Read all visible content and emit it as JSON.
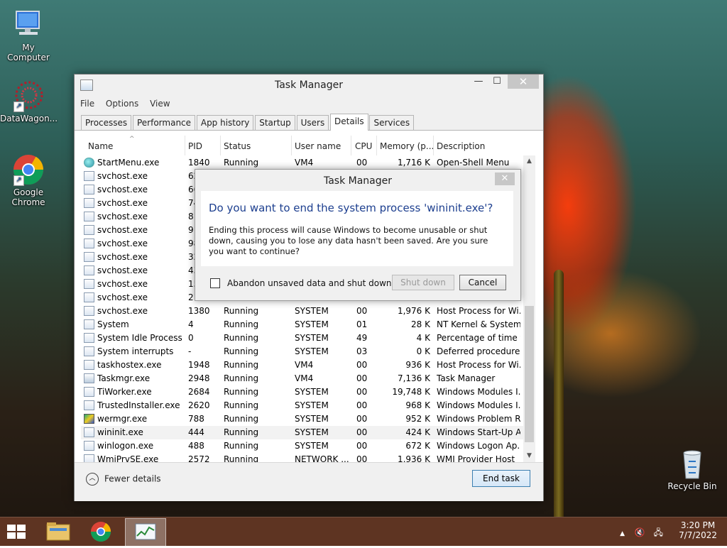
{
  "desktop": {
    "icons": [
      {
        "label": "My Computer"
      },
      {
        "label": "DataWagon..."
      },
      {
        "label": "Google\nChrome"
      },
      {
        "label": "Recycle Bin"
      }
    ]
  },
  "task_manager": {
    "title": "Task Manager",
    "menu": [
      "File",
      "Options",
      "View"
    ],
    "tabs": [
      "Processes",
      "Performance",
      "App history",
      "Startup",
      "Users",
      "Details",
      "Services"
    ],
    "active_tab": "Details",
    "columns": [
      "Name",
      "PID",
      "Status",
      "User name",
      "CPU",
      "Memory (p...",
      "Description"
    ],
    "rows": [
      {
        "name": "StartMenu.exe",
        "pid": "1840",
        "status": "Running",
        "user": "VM4",
        "cpu": "00",
        "mem": "1,716 K",
        "desc": "Open-Shell Menu",
        "icon": "start"
      },
      {
        "name": "svchost.exe",
        "pid": "62",
        "status": "",
        "user": "",
        "cpu": "",
        "mem": "",
        "desc": "",
        "icon": "svc"
      },
      {
        "name": "svchost.exe",
        "pid": "66",
        "status": "",
        "user": "",
        "cpu": "",
        "mem": "",
        "desc": "",
        "icon": "svc"
      },
      {
        "name": "svchost.exe",
        "pid": "74",
        "status": "",
        "user": "",
        "cpu": "",
        "mem": "",
        "desc": "",
        "icon": "svc"
      },
      {
        "name": "svchost.exe",
        "pid": "81",
        "status": "",
        "user": "",
        "cpu": "",
        "mem": "",
        "desc": "",
        "icon": "svc"
      },
      {
        "name": "svchost.exe",
        "pid": "91",
        "status": "",
        "user": "",
        "cpu": "",
        "mem": "",
        "desc": "",
        "icon": "svc"
      },
      {
        "name": "svchost.exe",
        "pid": "98",
        "status": "",
        "user": "",
        "cpu": "",
        "mem": "",
        "desc": "",
        "icon": "svc"
      },
      {
        "name": "svchost.exe",
        "pid": "32",
        "status": "",
        "user": "",
        "cpu": "",
        "mem": "",
        "desc": "",
        "icon": "svc"
      },
      {
        "name": "svchost.exe",
        "pid": "43",
        "status": "",
        "user": "",
        "cpu": "",
        "mem": "",
        "desc": "",
        "icon": "svc"
      },
      {
        "name": "svchost.exe",
        "pid": "15",
        "status": "",
        "user": "",
        "cpu": "",
        "mem": "",
        "desc": "",
        "icon": "svc"
      },
      {
        "name": "svchost.exe",
        "pid": "21",
        "status": "",
        "user": "",
        "cpu": "",
        "mem": "",
        "desc": "",
        "icon": "svc"
      },
      {
        "name": "svchost.exe",
        "pid": "1380",
        "status": "Running",
        "user": "SYSTEM",
        "cpu": "00",
        "mem": "1,976 K",
        "desc": "Host Process for Wi...",
        "icon": "svc"
      },
      {
        "name": "System",
        "pid": "4",
        "status": "Running",
        "user": "SYSTEM",
        "cpu": "01",
        "mem": "28 K",
        "desc": "NT Kernel & System",
        "icon": "svc"
      },
      {
        "name": "System Idle Process",
        "pid": "0",
        "status": "Running",
        "user": "SYSTEM",
        "cpu": "49",
        "mem": "4 K",
        "desc": "Percentage of time t...",
        "icon": "svc"
      },
      {
        "name": "System interrupts",
        "pid": "-",
        "status": "Running",
        "user": "SYSTEM",
        "cpu": "03",
        "mem": "0 K",
        "desc": "Deferred procedure ...",
        "icon": "svc"
      },
      {
        "name": "taskhostex.exe",
        "pid": "1948",
        "status": "Running",
        "user": "VM4",
        "cpu": "00",
        "mem": "936 K",
        "desc": "Host Process for Wi...",
        "icon": "svc"
      },
      {
        "name": "Taskmgr.exe",
        "pid": "2948",
        "status": "Running",
        "user": "VM4",
        "cpu": "00",
        "mem": "7,136 K",
        "desc": "Task Manager",
        "icon": "tm"
      },
      {
        "name": "TiWorker.exe",
        "pid": "2684",
        "status": "Running",
        "user": "SYSTEM",
        "cpu": "00",
        "mem": "19,748 K",
        "desc": "Windows Modules I...",
        "icon": "svc"
      },
      {
        "name": "TrustedInstaller.exe",
        "pid": "2620",
        "status": "Running",
        "user": "SYSTEM",
        "cpu": "00",
        "mem": "968 K",
        "desc": "Windows Modules I...",
        "icon": "svc"
      },
      {
        "name": "wermgr.exe",
        "pid": "788",
        "status": "Running",
        "user": "SYSTEM",
        "cpu": "00",
        "mem": "952 K",
        "desc": "Windows Problem R...",
        "icon": "wer"
      },
      {
        "name": "wininit.exe",
        "pid": "444",
        "status": "Running",
        "user": "SYSTEM",
        "cpu": "00",
        "mem": "424 K",
        "desc": "Windows Start-Up A...",
        "icon": "svc",
        "selected": true
      },
      {
        "name": "winlogon.exe",
        "pid": "488",
        "status": "Running",
        "user": "SYSTEM",
        "cpu": "00",
        "mem": "672 K",
        "desc": "Windows Logon Ap...",
        "icon": "svc"
      },
      {
        "name": "WmiPrvSE.exe",
        "pid": "2572",
        "status": "Running",
        "user": "NETWORK ...",
        "cpu": "00",
        "mem": "1,936 K",
        "desc": "WMI Provider Host",
        "icon": "svc"
      }
    ],
    "fewer_details": "Fewer details",
    "end_task": "End task"
  },
  "dialog": {
    "title": "Task Manager",
    "close": "✕",
    "main_instruction": "Do you want to end the system process 'wininit.exe'?",
    "content": "Ending this process will cause Windows to become unusable or shut down, causing you to lose any data hasn't been saved. Are you sure you want to continue?",
    "checkbox_label": "Abandon unsaved data and shut down.",
    "shutdown_button": "Shut down",
    "cancel_button": "Cancel"
  },
  "taskbar": {
    "time": "3:20 PM",
    "date": "7/7/2022"
  }
}
